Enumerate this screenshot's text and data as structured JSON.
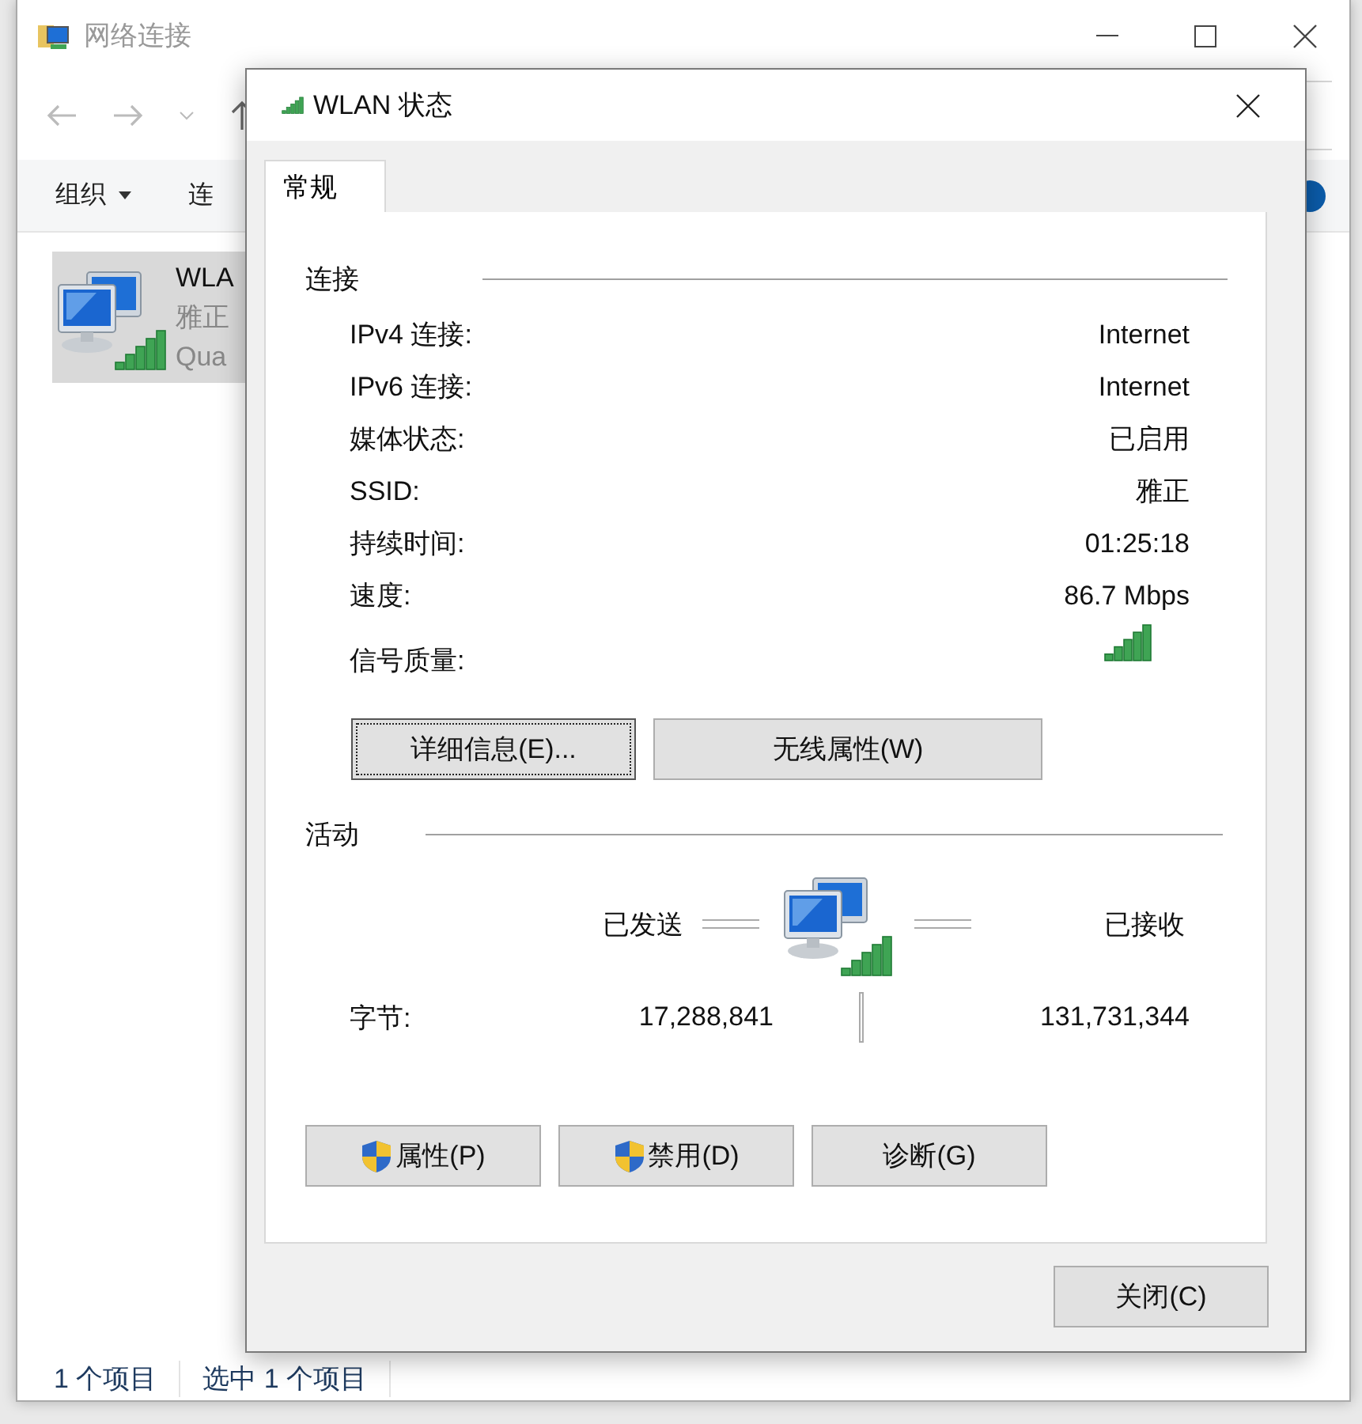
{
  "explorer": {
    "title": "网络连接",
    "toolbar": [
      {
        "label": "组织",
        "dropdown": true
      },
      {
        "label": "连",
        "dropdown": false
      }
    ],
    "items": [
      {
        "name": "WLA",
        "lines": [
          "雅正",
          "Qua"
        ],
        "selected": true
      }
    ],
    "status_bar": [
      "1 个项目",
      "选中 1 个项目"
    ]
  },
  "dialog": {
    "title": "WLAN 状态",
    "tabs": [
      {
        "label": "常规",
        "selected": true
      }
    ],
    "connection": {
      "heading": "连接",
      "rows": [
        {
          "label": "IPv4 连接:",
          "value": "Internet"
        },
        {
          "label": "IPv6 连接:",
          "value": "Internet"
        },
        {
          "label": "媒体状态:",
          "value": "已启用"
        },
        {
          "label": "SSID:",
          "value": "雅正"
        },
        {
          "label": "持续时间:",
          "value": "01:25:18"
        },
        {
          "label": "速度:",
          "value": "86.7 Mbps"
        }
      ],
      "signal_label": "信号质量:",
      "buttons": [
        {
          "label": "详细信息(E)...",
          "focused": true
        },
        {
          "label": "无线属性(W)",
          "focused": false
        }
      ]
    },
    "activity": {
      "heading": "活动",
      "sent_label": "已发送",
      "received_label": "已接收",
      "bytes_label": "字节:",
      "sent": "17,288,841",
      "received": "131,731,344"
    },
    "buttons": [
      {
        "label": "属性(P)",
        "shield": true
      },
      {
        "label": "禁用(D)",
        "shield": true
      },
      {
        "label": "诊断(G)",
        "shield": false
      }
    ],
    "close_button": "关闭(C)"
  }
}
